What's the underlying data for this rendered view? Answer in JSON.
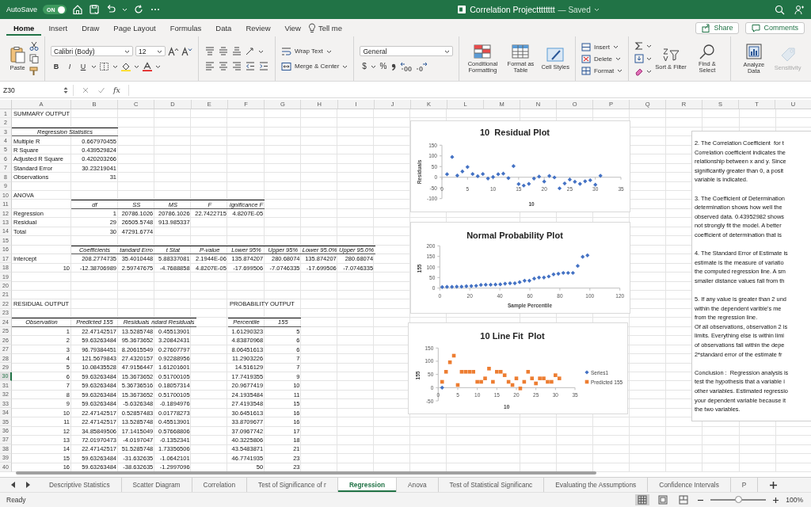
{
  "title_bar": {
    "autosave_label": "AutoSave",
    "autosave": {
      "on": true,
      "label": "ON"
    },
    "title": "Correlation Projectttttttt",
    "status": "— Saved"
  },
  "ribbon_tabs": [
    {
      "label": "Home",
      "selected": true
    },
    {
      "label": "Insert",
      "selected": false
    },
    {
      "label": "Draw",
      "selected": false
    },
    {
      "label": "Page Layout",
      "selected": false
    },
    {
      "label": "Formulas",
      "selected": false
    },
    {
      "label": "Data",
      "selected": false
    },
    {
      "label": "Review",
      "selected": false
    },
    {
      "label": "View",
      "selected": false
    }
  ],
  "tell_me": "Tell me",
  "share_button": "Share",
  "comments_button": "Comments",
  "ribbon": {
    "paste": "Paste",
    "font_name": "Calibri (Body)",
    "font_size": "12",
    "bold": "B",
    "italic": "I",
    "underline": "U",
    "wrap_text": "Wrap Text",
    "merge_center": "Merge & Center",
    "number_format": "General",
    "currency": "$",
    "percent": "%",
    "conditional_formatting": "Conditional Formatting",
    "format_as_table": "Format as Table",
    "cell_styles": "Cell Styles",
    "insert": "Insert",
    "delete": "Delete",
    "format": "Format",
    "sort_filter": "Sort & Filter",
    "find_select": "Find & Select",
    "analyze_data": "Analyze Data",
    "sensitivity": {
      "label": "Sensitivity",
      "disabled": true
    }
  },
  "formula_bar": {
    "name_box": "Z30",
    "fx": "fx"
  },
  "columns": [
    "A",
    "B",
    "C",
    "D",
    "E",
    "F",
    "G",
    "H",
    "I",
    "J",
    "K",
    "L",
    "M",
    "N",
    "O",
    "P",
    "Q",
    "R",
    "S",
    "T",
    "U"
  ],
  "rows": [
    {
      "number": "1",
      "selected": false,
      "cells": {
        "A": {
          "text": "SUMMARY OUTPUT",
          "kind": "label"
        }
      }
    },
    {
      "number": "2",
      "selected": false
    },
    {
      "number": "3",
      "selected": false,
      "cells": {
        "A": {
          "text": "Regression Statistics",
          "kind": "caption"
        }
      }
    },
    {
      "number": "4",
      "selected": false,
      "cells": {
        "A": {
          "text": "Multiple R",
          "kind": "label"
        },
        "B": {
          "text": "0.667970455",
          "kind": "number"
        }
      }
    },
    {
      "number": "5",
      "selected": false,
      "cells": {
        "A": {
          "text": "R Square",
          "kind": "label"
        },
        "B": {
          "text": "0.439529824",
          "kind": "number"
        }
      }
    },
    {
      "number": "6",
      "selected": false,
      "cells": {
        "A": {
          "text": "Adjusted R Square",
          "kind": "label"
        },
        "B": {
          "text": "0.420203266",
          "kind": "number"
        }
      }
    },
    {
      "number": "7",
      "selected": false,
      "cells": {
        "A": {
          "text": "Standard Error",
          "kind": "label"
        },
        "B": {
          "text": "30.23219041",
          "kind": "number"
        }
      }
    },
    {
      "number": "8",
      "selected": false,
      "cells": {
        "A": {
          "text": "Observations",
          "kind": "label"
        },
        "B": {
          "text": "31",
          "kind": "number"
        }
      }
    },
    {
      "number": "9",
      "selected": false
    },
    {
      "number": "10",
      "selected": false,
      "cells": {
        "A": {
          "text": "ANOVA",
          "kind": "label"
        }
      }
    },
    {
      "number": "11",
      "selected": false,
      "cells": {
        "B": {
          "text": "df",
          "kind": "header"
        },
        "C": {
          "text": "SS",
          "kind": "header"
        },
        "D": {
          "text": "MS",
          "kind": "header"
        },
        "E": {
          "text": "F",
          "kind": "header"
        },
        "F": {
          "text": "ignificance F",
          "kind": "header"
        }
      }
    },
    {
      "number": "12",
      "selected": false,
      "cells": {
        "A": {
          "text": "Regression",
          "kind": "label"
        },
        "B": {
          "text": "1",
          "kind": "number"
        },
        "C": {
          "text": "20786.1026",
          "kind": "number"
        },
        "D": {
          "text": "20786.1026",
          "kind": "number"
        },
        "E": {
          "text": "22.7422715",
          "kind": "number"
        },
        "F": {
          "text": "4.8207E-05",
          "kind": "number"
        }
      }
    },
    {
      "number": "13",
      "selected": false,
      "cells": {
        "A": {
          "text": "Residual",
          "kind": "label"
        },
        "B": {
          "text": "29",
          "kind": "number"
        },
        "C": {
          "text": "26505.5748",
          "kind": "number"
        },
        "D": {
          "text": "913.985337",
          "kind": "number"
        }
      }
    },
    {
      "number": "14",
      "selected": false,
      "cells": {
        "A": {
          "text": "Total",
          "kind": "label"
        },
        "B": {
          "text": "30",
          "kind": "number"
        },
        "C": {
          "text": "47291.6774",
          "kind": "number"
        }
      }
    },
    {
      "number": "15",
      "selected": false
    },
    {
      "number": "16",
      "selected": false,
      "cells": {
        "B": {
          "text": "Coefficients",
          "kind": "header"
        },
        "C": {
          "text": "tandard Erro",
          "kind": "header"
        },
        "D": {
          "text": "t Stat",
          "kind": "header"
        },
        "E": {
          "text": "P-value",
          "kind": "header"
        },
        "F": {
          "text": "Lower 95%",
          "kind": "header"
        },
        "G": {
          "text": "Upper 95%",
          "kind": "header"
        },
        "H": {
          "text": "Lower 95.0%",
          "kind": "header"
        },
        "I": {
          "text": "Upper 95.0%",
          "kind": "header"
        }
      }
    },
    {
      "number": "17",
      "selected": false,
      "cells": {
        "A": {
          "text": "Intercept",
          "kind": "label"
        },
        "B": {
          "text": "208.2774735",
          "kind": "number"
        },
        "C": {
          "text": "35.4010448",
          "kind": "number"
        },
        "D": {
          "text": "5.88337081",
          "kind": "number"
        },
        "E": {
          "text": "2.1944E-06",
          "kind": "number"
        },
        "F": {
          "text": "135.874207",
          "kind": "number"
        },
        "G": {
          "text": "280.68074",
          "kind": "number"
        },
        "H": {
          "text": "135.874207",
          "kind": "number"
        },
        "I": {
          "text": "280.68074",
          "kind": "number"
        }
      }
    },
    {
      "number": "18",
      "selected": false,
      "cells": {
        "A": {
          "text": "10",
          "kind": "number"
        },
        "B": {
          "text": "-12.38706989",
          "kind": "number"
        },
        "C": {
          "text": "2.59747675",
          "kind": "number"
        },
        "D": {
          "text": "-4.7688858",
          "kind": "number"
        },
        "E": {
          "text": "4.8207E-05",
          "kind": "number"
        },
        "F": {
          "text": "-17.699506",
          "kind": "number"
        },
        "G": {
          "text": "-7.0746335",
          "kind": "number"
        },
        "H": {
          "text": "-17.699506",
          "kind": "number"
        },
        "I": {
          "text": "-7.0746335",
          "kind": "number"
        }
      }
    },
    {
      "number": "19",
      "selected": false
    },
    {
      "number": "20",
      "selected": false
    },
    {
      "number": "21",
      "selected": false
    },
    {
      "number": "22",
      "selected": false,
      "cells": {
        "A": {
          "text": "RESIDUAL OUTPUT",
          "kind": "label"
        },
        "F": {
          "text": "PROBABILITY OUTPUT",
          "kind": "label"
        }
      }
    },
    {
      "number": "23",
      "selected": false
    },
    {
      "number": "24",
      "selected": false,
      "cells": {
        "A": {
          "text": "Observation",
          "kind": "header"
        },
        "B": {
          "text": "Predicted 155",
          "kind": "header"
        },
        "C": {
          "text": "Residuals",
          "kind": "header"
        },
        "D": {
          "text": "ndard Residuals",
          "kind": "header"
        },
        "F": {
          "text": "Percentile",
          "kind": "header"
        },
        "G": {
          "text": "155",
          "kind": "header"
        }
      }
    },
    {
      "number": "25",
      "selected": false,
      "cells": {
        "A": {
          "text": "1",
          "kind": "number"
        },
        "B": {
          "text": "22.47142517",
          "kind": "number"
        },
        "C": {
          "text": "13.5285748",
          "kind": "number"
        },
        "D": {
          "text": "0.45513901",
          "kind": "number"
        },
        "F": {
          "text": "1.61290323",
          "kind": "number"
        },
        "G": {
          "text": "5",
          "kind": "number"
        }
      }
    },
    {
      "number": "26",
      "selected": false,
      "cells": {
        "A": {
          "text": "2",
          "kind": "number"
        },
        "B": {
          "text": "59.63263484",
          "kind": "number"
        },
        "C": {
          "text": "95.3673652",
          "kind": "number"
        },
        "D": {
          "text": "3.20842431",
          "kind": "number"
        },
        "F": {
          "text": "4.83870968",
          "kind": "number"
        },
        "G": {
          "text": "6",
          "kind": "number"
        }
      }
    },
    {
      "number": "27",
      "selected": false,
      "cells": {
        "A": {
          "text": "3",
          "kind": "number"
        },
        "B": {
          "text": "96.79384451",
          "kind": "number"
        },
        "C": {
          "text": "8.20615549",
          "kind": "number"
        },
        "D": {
          "text": "0.27607797",
          "kind": "number"
        },
        "F": {
          "text": "8.06451613",
          "kind": "number"
        },
        "G": {
          "text": "6",
          "kind": "number"
        }
      }
    },
    {
      "number": "28",
      "selected": false,
      "cells": {
        "A": {
          "text": "4",
          "kind": "number"
        },
        "B": {
          "text": "121.5679843",
          "kind": "number"
        },
        "C": {
          "text": "27.4320157",
          "kind": "number"
        },
        "D": {
          "text": "0.92288956",
          "kind": "number"
        },
        "F": {
          "text": "11.2903226",
          "kind": "number"
        },
        "G": {
          "text": "7",
          "kind": "number"
        }
      }
    },
    {
      "number": "29",
      "selected": false,
      "cells": {
        "A": {
          "text": "5",
          "kind": "number"
        },
        "B": {
          "text": "10.08435528",
          "kind": "number"
        },
        "C": {
          "text": "47.9156447",
          "kind": "number"
        },
        "D": {
          "text": "1.61201601",
          "kind": "number"
        },
        "F": {
          "text": "14.516129",
          "kind": "number"
        },
        "G": {
          "text": "7",
          "kind": "number"
        }
      }
    },
    {
      "number": "30",
      "selected": true,
      "cells": {
        "A": {
          "text": "6",
          "kind": "number"
        },
        "B": {
          "text": "59.63263484",
          "kind": "number"
        },
        "C": {
          "text": "15.3673652",
          "kind": "number"
        },
        "D": {
          "text": "0.51700105",
          "kind": "number"
        },
        "F": {
          "text": "17.7419355",
          "kind": "number"
        },
        "G": {
          "text": "9",
          "kind": "number"
        }
      }
    },
    {
      "number": "31",
      "selected": false,
      "cells": {
        "A": {
          "text": "7",
          "kind": "number"
        },
        "B": {
          "text": "59.63263484",
          "kind": "number"
        },
        "C": {
          "text": "5.36736516",
          "kind": "number"
        },
        "D": {
          "text": "0.18057314",
          "kind": "number"
        },
        "F": {
          "text": "20.9677419",
          "kind": "number"
        },
        "G": {
          "text": "10",
          "kind": "number"
        }
      }
    },
    {
      "number": "32",
      "selected": false,
      "cells": {
        "A": {
          "text": "8",
          "kind": "number"
        },
        "B": {
          "text": "59.63263484",
          "kind": "number"
        },
        "C": {
          "text": "15.3673652",
          "kind": "number"
        },
        "D": {
          "text": "0.51700105",
          "kind": "number"
        },
        "F": {
          "text": "24.1935484",
          "kind": "number"
        },
        "G": {
          "text": "11",
          "kind": "number"
        }
      }
    },
    {
      "number": "33",
      "selected": false,
      "cells": {
        "A": {
          "text": "9",
          "kind": "number"
        },
        "B": {
          "text": "59.63263484",
          "kind": "number"
        },
        "C": {
          "text": "-5.6326348",
          "kind": "number"
        },
        "D": {
          "text": "-0.1894976",
          "kind": "number"
        },
        "F": {
          "text": "27.4193548",
          "kind": "number"
        },
        "G": {
          "text": "15",
          "kind": "number"
        }
      }
    },
    {
      "number": "34",
      "selected": false,
      "cells": {
        "A": {
          "text": "10",
          "kind": "number"
        },
        "B": {
          "text": "22.47142517",
          "kind": "number"
        },
        "C": {
          "text": "0.52857483",
          "kind": "number"
        },
        "D": {
          "text": "0.01778273",
          "kind": "number"
        },
        "F": {
          "text": "30.6451613",
          "kind": "number"
        },
        "G": {
          "text": "16",
          "kind": "number"
        }
      }
    },
    {
      "number": "35",
      "selected": false,
      "cells": {
        "A": {
          "text": "11",
          "kind": "number"
        },
        "B": {
          "text": "22.47142517",
          "kind": "number"
        },
        "C": {
          "text": "13.5285748",
          "kind": "number"
        },
        "D": {
          "text": "0.45513901",
          "kind": "number"
        },
        "F": {
          "text": "33.8709677",
          "kind": "number"
        },
        "G": {
          "text": "16",
          "kind": "number"
        }
      }
    },
    {
      "number": "36",
      "selected": false,
      "cells": {
        "A": {
          "text": "12",
          "kind": "number"
        },
        "B": {
          "text": "34.85849506",
          "kind": "number"
        },
        "C": {
          "text": "17.1415049",
          "kind": "number"
        },
        "D": {
          "text": "0.57668806",
          "kind": "number"
        },
        "F": {
          "text": "37.0967742",
          "kind": "number"
        },
        "G": {
          "text": "17",
          "kind": "number"
        }
      }
    },
    {
      "number": "37",
      "selected": false,
      "cells": {
        "A": {
          "text": "13",
          "kind": "number"
        },
        "B": {
          "text": "72.01970473",
          "kind": "number"
        },
        "C": {
          "text": "-4.0197047",
          "kind": "number"
        },
        "D": {
          "text": "-0.1352341",
          "kind": "number"
        },
        "F": {
          "text": "40.3225806",
          "kind": "number"
        },
        "G": {
          "text": "18",
          "kind": "number"
        }
      }
    },
    {
      "number": "38",
      "selected": false,
      "cells": {
        "A": {
          "text": "14",
          "kind": "number"
        },
        "B": {
          "text": "22.47142517",
          "kind": "number"
        },
        "C": {
          "text": "51.5285748",
          "kind": "number"
        },
        "D": {
          "text": "1.73356506",
          "kind": "number"
        },
        "F": {
          "text": "43.5483871",
          "kind": "number"
        },
        "G": {
          "text": "21",
          "kind": "number"
        }
      }
    },
    {
      "number": "39",
      "selected": false,
      "cells": {
        "A": {
          "text": "15",
          "kind": "number"
        },
        "B": {
          "text": "59.63263484",
          "kind": "number"
        },
        "C": {
          "text": "-31.632635",
          "kind": "number"
        },
        "D": {
          "text": "-1.0642101",
          "kind": "number"
        },
        "F": {
          "text": "46.7741935",
          "kind": "number"
        },
        "G": {
          "text": "23",
          "kind": "number"
        }
      }
    },
    {
      "number": "40",
      "selected": false,
      "cells": {
        "A": {
          "text": "16",
          "kind": "number"
        },
        "B": {
          "text": "59.63263484",
          "kind": "number"
        },
        "C": {
          "text": "-38.632635",
          "kind": "number"
        },
        "D": {
          "text": "-1.2997096",
          "kind": "number"
        },
        "F": {
          "text": "50",
          "kind": "number"
        },
        "G": {
          "text": "23",
          "kind": "number"
        }
      }
    }
  ],
  "charts": [
    {
      "chart_data": {
        "type": "scatter",
        "title": "10  Residual Plot",
        "xlabel": "10",
        "ylabel": "Residuals",
        "xlim": [
          0,
          35
        ],
        "ylim": [
          -100,
          150
        ],
        "xticks": [
          {
            "value": 0,
            "label": "0"
          },
          {
            "value": 5,
            "label": "5"
          },
          {
            "value": 10,
            "label": "10"
          },
          {
            "value": 15,
            "label": "15"
          },
          {
            "value": 20,
            "label": "20"
          },
          {
            "value": 25,
            "label": "25"
          },
          {
            "value": 30,
            "label": "30"
          },
          {
            "value": 35,
            "label": "35"
          }
        ],
        "yticks": [
          {
            "value": -100,
            "label": "-100"
          },
          {
            "value": -50,
            "label": "-50"
          },
          {
            "value": 0,
            "label": "0"
          },
          {
            "value": 50,
            "label": "50"
          },
          {
            "value": 100,
            "label": "100"
          },
          {
            "value": 150,
            "label": "150"
          }
        ],
        "x": [
          1,
          2,
          3,
          4,
          5,
          6,
          7,
          8,
          9,
          10,
          11,
          12,
          13,
          14,
          15,
          16,
          17,
          18,
          19,
          20,
          21,
          22,
          23,
          24,
          25,
          26,
          27,
          28,
          29,
          30,
          31
        ],
        "series": [
          {
            "color": "#4472c4",
            "values": [
              14,
              95,
              8,
              27,
              48,
              15,
              5,
              15,
              -6,
              1,
              14,
              17,
              -4,
              52,
              -32,
              -39,
              -31,
              -6,
              3,
              -20,
              6,
              -1,
              -52,
              -29,
              -11,
              -21,
              -31,
              -19,
              -14,
              -35,
              7
            ]
          }
        ]
      }
    },
    {
      "chart_data": {
        "type": "scatter",
        "title": "Normal Probability Plot",
        "xlabel": "Sample Percentile",
        "ylabel": "155",
        "xlim": [
          0,
          120
        ],
        "ylim": [
          0,
          200
        ],
        "xticks": [
          {
            "value": 0,
            "label": "0"
          },
          {
            "value": 20,
            "label": "20"
          },
          {
            "value": 40,
            "label": "40"
          },
          {
            "value": 60,
            "label": "60"
          },
          {
            "value": 80,
            "label": "80"
          },
          {
            "value": 100,
            "label": "100"
          },
          {
            "value": 120,
            "label": "120"
          }
        ],
        "yticks": [
          {
            "value": 0,
            "label": "0"
          },
          {
            "value": 50,
            "label": "50"
          },
          {
            "value": 100,
            "label": "100"
          },
          {
            "value": 150,
            "label": "150"
          },
          {
            "value": 200,
            "label": "200"
          }
        ],
        "x": [
          1.6,
          4.8,
          8.1,
          11.3,
          14.5,
          17.7,
          21,
          24.2,
          27.4,
          30.6,
          33.9,
          37.1,
          40.3,
          43.5,
          46.8,
          50,
          53.2,
          56.5,
          59.7,
          62.9,
          66.1,
          69.4,
          72.6,
          75.8,
          79,
          82.3,
          85.5,
          88.7,
          91.9,
          95.2,
          98.4
        ],
        "series": [
          {
            "color": "#4472c4",
            "values": [
              5,
              6,
              6,
              7,
              7,
              9,
              10,
              11,
              15,
              16,
              16,
              17,
              18,
              21,
              23,
              23,
              28,
              35,
              35,
              45,
              50,
              50,
              55,
              65,
              68,
              72,
              72,
              72,
              105,
              148,
              155
            ]
          }
        ]
      }
    },
    {
      "chart_data": {
        "type": "scatter",
        "title": "10 Line Fit  Plot",
        "xlabel": "10",
        "ylabel": "155",
        "xlim": [
          0,
          35
        ],
        "ylim": [
          -50,
          150
        ],
        "xticks": [
          {
            "value": 0,
            "label": "0"
          },
          {
            "value": 5,
            "label": "5"
          },
          {
            "value": 10,
            "label": "10"
          },
          {
            "value": 15,
            "label": "15"
          },
          {
            "value": 20,
            "label": "20"
          },
          {
            "value": 25,
            "label": "25"
          },
          {
            "value": 30,
            "label": "30"
          },
          {
            "value": 35,
            "label": "35"
          }
        ],
        "yticks": [
          {
            "value": -50,
            "label": "-50"
          },
          {
            "value": 0,
            "label": "0"
          },
          {
            "value": 50,
            "label": "50"
          },
          {
            "value": 100,
            "label": "100"
          },
          {
            "value": 150,
            "label": "150"
          }
        ],
        "legend": true,
        "x": [
          1,
          2,
          3,
          4,
          5,
          6,
          7,
          8,
          9,
          10,
          11,
          12,
          13,
          14,
          15,
          16,
          17,
          18,
          19,
          20,
          21,
          22,
          23,
          24,
          25,
          26,
          27,
          28,
          29,
          30,
          31
        ],
        "series": [
          {
            "name": "Series1",
            "color": "#4472c4",
            "values": [
              0,
              null,
              null,
              null,
              null,
              null,
              null,
              null,
              null,
              null,
              null,
              null,
              null,
              null,
              null,
              null,
              null,
              null,
              null,
              null,
              null,
              null,
              null,
              null,
              null,
              null,
              null,
              null,
              null,
              null,
              null
            ]
          },
          {
            "name": "Predicted 155",
            "color": "#ed7d31",
            "values": [
              22,
              60,
              96,
              121,
              10,
              60,
              60,
              60,
              60,
              22,
              22,
              35,
              72,
              22,
              60,
              60,
              47,
              22,
              10,
              35,
              -3,
              22,
              60,
              35,
              16,
              35,
              35,
              22,
              22,
              47,
              35
            ]
          }
        ]
      }
    }
  ],
  "text_box": {
    "paragraphs": [
      [
        "2. The Correlation Coefficient  for t",
        "Correlation coefficient indicates the",
        "relationship between x and y. Since",
        "significantly greater than 0, a posit",
        "variable is indicated."
      ],
      [
        "3. The Coefficient of Determination",
        "determination shows how well the",
        "observed data. 0.43952982 shows",
        "not strongly fit the model. A better",
        "coefficient of determination that is"
      ],
      [
        "4. The Standard Error of Estimate is",
        "estimate is the measure of variatio",
        "the computed regression line. A sm",
        "smaller distance values fall from th"
      ],
      [
        "5. If any value is greater than 2 und",
        "within the dependent varible's me",
        "from the regression line.",
        "Of all observations, observation 2 is",
        "limits. Everything else is within limi",
        "of observations fall within the depe",
        "2*standard error of the estimate fr"
      ],
      [
        "Conclusion :  Regression analysis is",
        "test the hypothesis that a variable i",
        "other variables. Estimated regressio",
        "your dependent variable because it",
        "the two variables."
      ]
    ]
  },
  "sheet_tabs": [
    {
      "label": "Descriptive Statistics",
      "selected": false
    },
    {
      "label": "Scatter Diagram",
      "selected": false
    },
    {
      "label": "Correlation",
      "selected": false
    },
    {
      "label": "Test of Significance of r",
      "selected": false
    },
    {
      "label": "Regression",
      "selected": true
    },
    {
      "label": "Anova",
      "selected": false
    },
    {
      "label": "Test of Statistical Significanc",
      "selected": false
    },
    {
      "label": "Evaluating the Assumptions",
      "selected": false
    },
    {
      "label": "Confidence Intervals",
      "selected": false
    },
    {
      "label": "P",
      "selected": false
    }
  ],
  "status_bar": {
    "status": "Ready",
    "views": [
      {
        "kind": "normal",
        "selected": true
      },
      {
        "kind": "page-layout",
        "selected": false
      },
      {
        "kind": "page-break",
        "selected": false
      }
    ],
    "zoom": {
      "level": 0.5,
      "reading": "100%"
    }
  }
}
